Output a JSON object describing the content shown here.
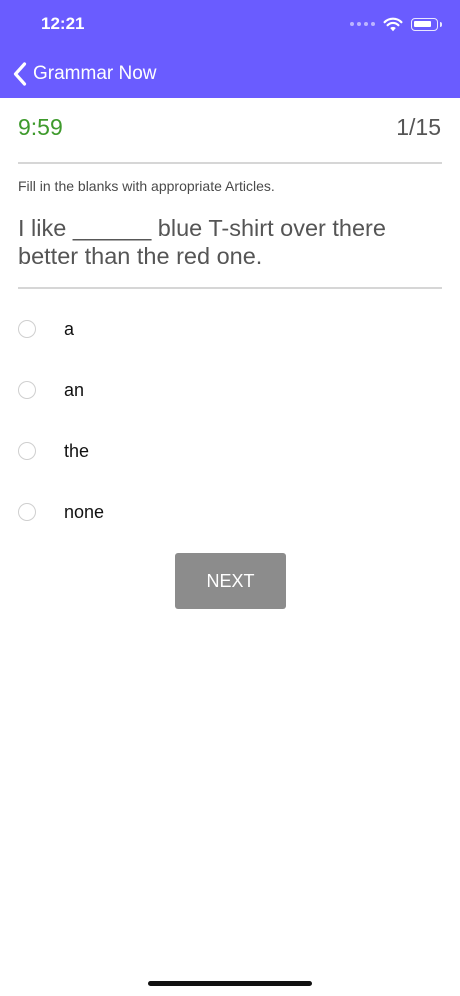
{
  "status_bar": {
    "time": "12:21",
    "icons": [
      "cellular-signal-icon",
      "wifi-icon",
      "battery-icon"
    ]
  },
  "nav": {
    "back_label": "Grammar Now",
    "back_icon": "chevron-left-icon",
    "background_color": "#6a5cff"
  },
  "quiz": {
    "timer": "9:59",
    "timer_color": "#3e9a2c",
    "counter": "1/15",
    "instruction": "Fill in the blanks with appropriate Articles.",
    "question": "I like ______ blue T-shirt over there better than the red one.",
    "options": [
      {
        "label": "a",
        "selected": false
      },
      {
        "label": "an",
        "selected": false
      },
      {
        "label": "the",
        "selected": false
      },
      {
        "label": "none",
        "selected": false
      }
    ],
    "next_label": "NEXT"
  }
}
